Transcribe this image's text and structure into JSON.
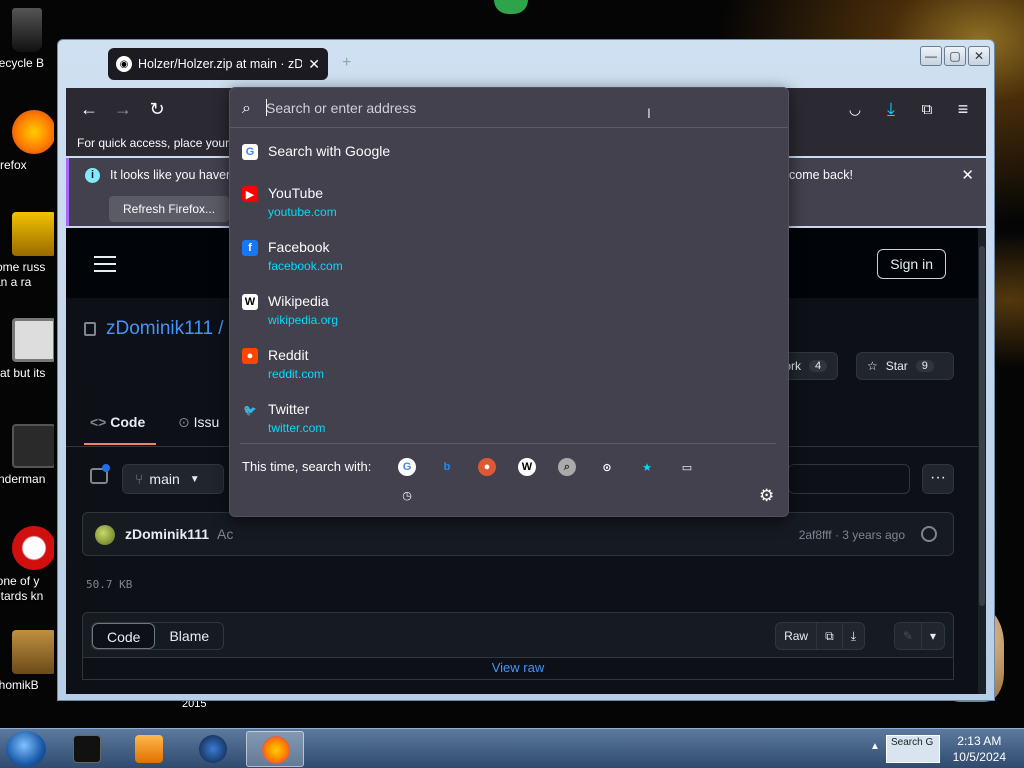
{
  "desktop": {
    "icons": [
      {
        "label": "Recycle B",
        "color": "#333"
      },
      {
        "label": "Firefox",
        "color": "#ff9400"
      },
      {
        "label": "some russ ran a ra",
        "color": "#e0a000"
      },
      {
        "label": "that but its",
        "color": "#888"
      },
      {
        "label": "Enderman",
        "color": "#444"
      },
      {
        "label": "none of y retards kn",
        "color": "#c00"
      },
      {
        "label": "ChomikB",
        "color": "#b8862a"
      }
    ],
    "year_label": "2015"
  },
  "browser": {
    "tab_title": "Holzer/Holzer.zip at main · zDo",
    "tab_close": "✕",
    "new_tab": "+",
    "window_buttons": [
      "—",
      "▢",
      "✕"
    ],
    "bookmarks_text": "For quick access, place your b",
    "notice": {
      "text_left": "It looks like you haven",
      "text_right": "come back!",
      "button": "Refresh Firefox...",
      "close": "✕"
    }
  },
  "urlbar": {
    "placeholder": "Search or enter address",
    "suggestions": [
      {
        "label": "Search with Google",
        "sub": "",
        "icon": "google-icon",
        "icon_text": "G",
        "icon_color": "#4285f4",
        "icon_bg": "#fff"
      },
      {
        "label": "YouTube",
        "sub": "youtube.com",
        "icon": "youtube-icon",
        "icon_text": "▶",
        "icon_color": "#fff",
        "icon_bg": "#ff0000"
      },
      {
        "label": "Facebook",
        "sub": "facebook.com",
        "icon": "facebook-icon",
        "icon_text": "f",
        "icon_color": "#fff",
        "icon_bg": "#1877f2"
      },
      {
        "label": "Wikipedia",
        "sub": "wikipedia.org",
        "icon": "wikipedia-icon",
        "icon_text": "W",
        "icon_color": "#000",
        "icon_bg": "#fff"
      },
      {
        "label": "Reddit",
        "sub": "reddit.com",
        "icon": "reddit-icon",
        "icon_text": "●",
        "icon_color": "#fff",
        "icon_bg": "#ff4500"
      },
      {
        "label": "Twitter",
        "sub": "twitter.com",
        "icon": "twitter-icon",
        "icon_text": "🐦",
        "icon_color": "#1da1f2",
        "icon_bg": "transparent"
      }
    ],
    "search_with_label": "This time, search with:",
    "engines": [
      {
        "name": "google-engine-icon",
        "text": "G",
        "color": "#4285f4",
        "bg": "#fff"
      },
      {
        "name": "bing-engine-icon",
        "text": "b",
        "color": "#1a8cff",
        "bg": "transparent"
      },
      {
        "name": "duckduckgo-engine-icon",
        "text": "●",
        "color": "#fff",
        "bg": "#de5833"
      },
      {
        "name": "wikipedia-engine-icon",
        "text": "W",
        "color": "#000",
        "bg": "#fff"
      },
      {
        "name": "search-engine-icon",
        "text": "⌕",
        "color": "#333",
        "bg": "#aaa"
      },
      {
        "name": "github-engine-icon",
        "text": "⊙",
        "color": "#fff",
        "bg": "transparent"
      },
      {
        "name": "bookmarks-icon",
        "text": "★",
        "color": "#00ddff",
        "bg": "transparent"
      },
      {
        "name": "tabs-icon",
        "text": "▭",
        "color": "#fbfbfe",
        "bg": "transparent"
      },
      {
        "name": "history-icon",
        "text": "◷",
        "color": "#fbfbfe",
        "bg": "transparent"
      }
    ],
    "settings_icon": "⚙"
  },
  "github": {
    "signin": "Sign in",
    "owner": "zDominik111",
    "owner_suffix": " /",
    "fork_label": "Fork",
    "fork_count": "4",
    "star_label": "Star",
    "star_count": "9",
    "nav_code": "Code",
    "nav_issues": "Issu",
    "branch": "main",
    "more": "···",
    "commit_author": "zDominik111",
    "commit_partial": "Ac",
    "commit_meta": "2af8fff · 3 years ago",
    "file_size": "50.7 KB",
    "view_code": "Code",
    "view_blame": "Blame",
    "raw": "Raw",
    "view_raw": "View raw"
  },
  "taskbar": {
    "time": "2:13 AM",
    "date": "10/5/2024",
    "tray_thumb": "Search G"
  }
}
